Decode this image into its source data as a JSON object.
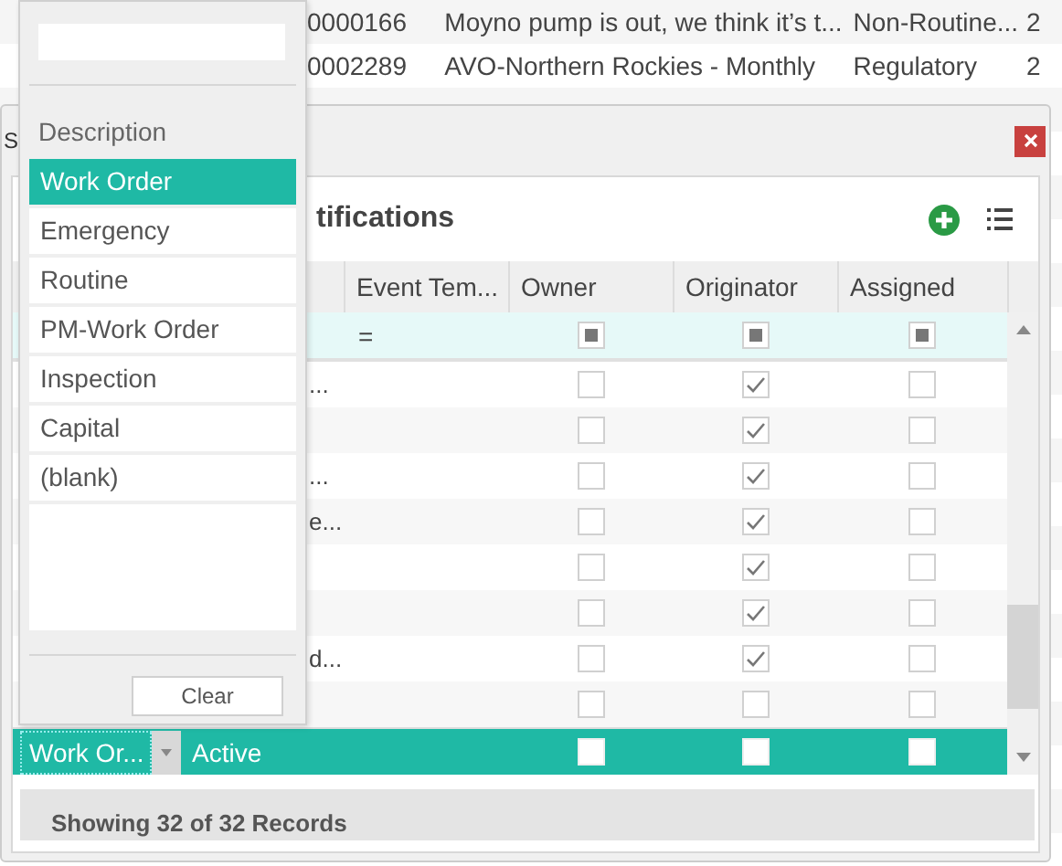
{
  "background_table": {
    "rows": [
      {
        "id": "0000166",
        "description": "Moyno pump is out, we think it’s t...",
        "type": "Non-Routine...",
        "column_4": "2"
      },
      {
        "id": "0002289",
        "description": "AVO-Northern Rockies - Monthly",
        "type": "Regulatory",
        "column_4": "2"
      },
      {},
      {},
      {},
      {},
      {},
      {},
      {},
      {},
      {},
      {},
      {},
      {},
      {},
      {},
      {},
      {},
      {},
      {}
    ]
  },
  "dialog": {
    "title": "S",
    "panel_title": "tifications",
    "columns": [
      "Event Tem...",
      "Owner",
      "Originator",
      "Assigned"
    ],
    "filter": {
      "operator": "=",
      "checkboxes": [
        {
          "indeterminate": true
        },
        {
          "indeterminate": true
        },
        {
          "indeterminate": true
        }
      ]
    },
    "rows": [
      {
        "text": "...",
        "owner": false,
        "originator": true,
        "assigned": false
      },
      {
        "owner": false,
        "originator": true,
        "assigned": false
      },
      {
        "text": "...",
        "owner": false,
        "originator": true,
        "assigned": false
      },
      {
        "text": "e...",
        "owner": false,
        "originator": true,
        "assigned": false
      },
      {
        "owner": false,
        "originator": true,
        "assigned": false
      },
      {
        "owner": false,
        "originator": true,
        "assigned": false
      },
      {
        "text": "d...",
        "owner": false,
        "originator": true,
        "assigned": false
      },
      {
        "owner": false,
        "originator": false,
        "assigned": false
      }
    ],
    "edit_row": {
      "selected": true,
      "editor_value": "Work Or...",
      "status": "Active",
      "owner": false,
      "originator": false,
      "assigned": false
    },
    "status": "Showing 32 of 32 Records"
  },
  "filter_popup": {
    "header": "Description",
    "items": [
      {
        "label": "Work Order",
        "selected": true
      },
      {
        "label": "Emergency",
        "selected": false
      },
      {
        "label": "Routine",
        "selected": false
      },
      {
        "label": "PM-Work Order",
        "selected": false
      },
      {
        "label": "Inspection",
        "selected": false
      },
      {
        "label": "Capital",
        "selected": false
      },
      {
        "label": "(blank)",
        "selected": false
      }
    ],
    "clear_button": "Clear"
  }
}
